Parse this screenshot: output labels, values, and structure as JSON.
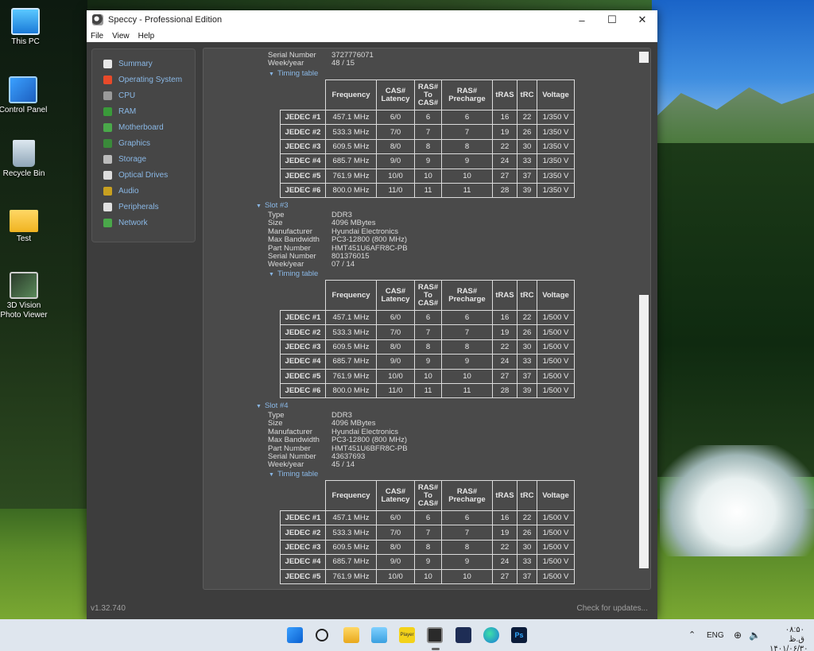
{
  "desktop": {
    "icons": [
      {
        "label": "This PC",
        "icon": "this-pc-icon"
      },
      {
        "label": "Control Panel",
        "icon": "control-panel-icon"
      },
      {
        "label": "Recycle Bin",
        "icon": "recycle-bin-icon"
      },
      {
        "label": "Test",
        "icon": "folder-icon"
      },
      {
        "label": "3D Vision Photo Viewer",
        "icon": "3d-vision-icon"
      }
    ]
  },
  "window": {
    "title": "Speccy - Professional Edition",
    "buttons": {
      "minimize": "–",
      "maximize": "☐",
      "close": "✕"
    },
    "menu": [
      "File",
      "View",
      "Help"
    ]
  },
  "sidebar": {
    "items": [
      {
        "label": "Summary",
        "icon": "summary-icon",
        "color": "#e7e7e7"
      },
      {
        "label": "Operating System",
        "icon": "windows-icon",
        "color": "#e84a2a"
      },
      {
        "label": "CPU",
        "icon": "cpu-icon",
        "color": "#9a9a9a"
      },
      {
        "label": "RAM",
        "icon": "ram-icon",
        "color": "#3a9a3a"
      },
      {
        "label": "Motherboard",
        "icon": "motherboard-icon",
        "color": "#4aa84a"
      },
      {
        "label": "Graphics",
        "icon": "graphics-icon",
        "color": "#3a8a3a"
      },
      {
        "label": "Storage",
        "icon": "storage-icon",
        "color": "#bbbbbb"
      },
      {
        "label": "Optical Drives",
        "icon": "optical-drive-icon",
        "color": "#dddddd"
      },
      {
        "label": "Audio",
        "icon": "audio-icon",
        "color": "#c8a020"
      },
      {
        "label": "Peripherals",
        "icon": "mouse-icon",
        "color": "#e0e0e0"
      },
      {
        "label": "Network",
        "icon": "network-icon",
        "color": "#4aa84a"
      }
    ]
  },
  "content": {
    "top_fields": [
      {
        "key": "Serial Number",
        "value": "3727776071"
      },
      {
        "key": "Week/year",
        "value": "48 / 15"
      }
    ],
    "timing_label": "Timing table",
    "headers": [
      "Frequency",
      "CAS#\nLatency",
      "RAS#\nTo\nCAS#",
      "RAS#\nPrecharge",
      "tRAS",
      "tRC",
      "Voltage"
    ],
    "tables": [
      {
        "rows": [
          [
            "JEDEC #1",
            "457.1 MHz",
            "6/0",
            "6",
            "6",
            "16",
            "22",
            "1/350 V"
          ],
          [
            "JEDEC #2",
            "533.3 MHz",
            "7/0",
            "7",
            "7",
            "19",
            "26",
            "1/350 V"
          ],
          [
            "JEDEC #3",
            "609.5 MHz",
            "8/0",
            "8",
            "8",
            "22",
            "30",
            "1/350 V"
          ],
          [
            "JEDEC #4",
            "685.7 MHz",
            "9/0",
            "9",
            "9",
            "24",
            "33",
            "1/350 V"
          ],
          [
            "JEDEC #5",
            "761.9 MHz",
            "10/0",
            "10",
            "10",
            "27",
            "37",
            "1/350 V"
          ],
          [
            "JEDEC #6",
            "800.0 MHz",
            "11/0",
            "11",
            "11",
            "28",
            "39",
            "1/350 V"
          ]
        ]
      },
      {
        "rows": [
          [
            "JEDEC #1",
            "457.1 MHz",
            "6/0",
            "6",
            "6",
            "16",
            "22",
            "1/500 V"
          ],
          [
            "JEDEC #2",
            "533.3 MHz",
            "7/0",
            "7",
            "7",
            "19",
            "26",
            "1/500 V"
          ],
          [
            "JEDEC #3",
            "609.5 MHz",
            "8/0",
            "8",
            "8",
            "22",
            "30",
            "1/500 V"
          ],
          [
            "JEDEC #4",
            "685.7 MHz",
            "9/0",
            "9",
            "9",
            "24",
            "33",
            "1/500 V"
          ],
          [
            "JEDEC #5",
            "761.9 MHz",
            "10/0",
            "10",
            "10",
            "27",
            "37",
            "1/500 V"
          ],
          [
            "JEDEC #6",
            "800.0 MHz",
            "11/0",
            "11",
            "11",
            "28",
            "39",
            "1/500 V"
          ]
        ]
      },
      {
        "rows": [
          [
            "JEDEC #1",
            "457.1 MHz",
            "6/0",
            "6",
            "6",
            "16",
            "22",
            "1/500 V"
          ],
          [
            "JEDEC #2",
            "533.3 MHz",
            "7/0",
            "7",
            "7",
            "19",
            "26",
            "1/500 V"
          ],
          [
            "JEDEC #3",
            "609.5 MHz",
            "8/0",
            "8",
            "8",
            "22",
            "30",
            "1/500 V"
          ],
          [
            "JEDEC #4",
            "685.7 MHz",
            "9/0",
            "9",
            "9",
            "24",
            "33",
            "1/500 V"
          ],
          [
            "JEDEC #5",
            "761.9 MHz",
            "10/0",
            "10",
            "10",
            "27",
            "37",
            "1/500 V"
          ]
        ]
      }
    ],
    "slots": [
      {
        "label": "Slot #3",
        "fields": [
          {
            "key": "Type",
            "value": "DDR3"
          },
          {
            "key": "Size",
            "value": "4096 MBytes"
          },
          {
            "key": "Manufacturer",
            "value": "Hyundai Electronics"
          },
          {
            "key": "Max Bandwidth",
            "value": "PC3-12800 (800 MHz)"
          },
          {
            "key": "Part Number",
            "value": "HMT451U6AFR8C-PB"
          },
          {
            "key": "Serial Number",
            "value": "801376015"
          },
          {
            "key": "Week/year",
            "value": "07 / 14"
          }
        ]
      },
      {
        "label": "Slot #4",
        "fields": [
          {
            "key": "Type",
            "value": "DDR3"
          },
          {
            "key": "Size",
            "value": "4096 MBytes"
          },
          {
            "key": "Manufacturer",
            "value": "Hyundai Electronics"
          },
          {
            "key": "Max Bandwidth",
            "value": "PC3-12800 (800 MHz)"
          },
          {
            "key": "Part Number",
            "value": "HMT451U6BFR8C-PB"
          },
          {
            "key": "Serial Number",
            "value": "43637693"
          },
          {
            "key": "Week/year",
            "value": "45 / 14"
          }
        ]
      }
    ]
  },
  "statusbar": {
    "version": "v1.32.740",
    "updates": "Check for updates..."
  },
  "taskbar": {
    "apps": [
      "start-icon",
      "search-icon",
      "file-explorer-icon",
      "app-icon",
      "player-icon",
      "speccy-icon",
      "app-icon",
      "edge-icon",
      "photoshop-icon"
    ],
    "player_text": "Player",
    "ps_text": "Ps",
    "language": "ENG",
    "time": "۰۸:۵۰ ق.ظ",
    "date": "۱۴۰۱/۰۶/۳۰"
  }
}
